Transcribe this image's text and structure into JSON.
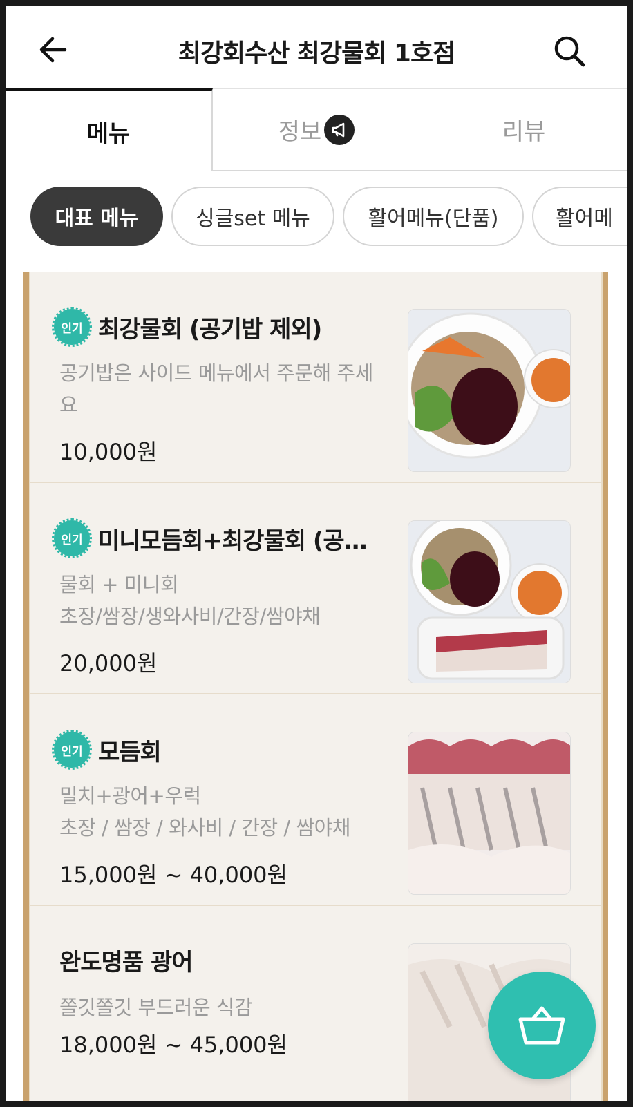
{
  "header": {
    "title": "최강회수산 최강물회 1호점",
    "back_icon": "arrow-left-icon",
    "search_icon": "search-icon"
  },
  "tabs": [
    {
      "label": "메뉴",
      "active": true
    },
    {
      "label": "정보",
      "icon": "megaphone-icon"
    },
    {
      "label": "리뷰"
    }
  ],
  "chips": [
    {
      "label": "대표 메뉴",
      "active": true
    },
    {
      "label": "싱글set 메뉴"
    },
    {
      "label": "활어메뉴(단품)"
    },
    {
      "label": "활어메"
    }
  ],
  "items": [
    {
      "badge": "인기",
      "name": "최강물회 (공기밥 제외)",
      "desc": "공기밥은 사이드 메뉴에서 주문해 주세요",
      "desc2": "",
      "price": "10,000원"
    },
    {
      "badge": "인기",
      "name": "미니모듬회+최강물회 (공기밥 제외)",
      "desc": "물회 + 미니회",
      "desc2": "초장/쌈장/생와사비/간장/쌈야채",
      "price": "20,000원"
    },
    {
      "badge": "인기",
      "name": "모듬회",
      "desc": "밀치+광어+우럭",
      "desc2": "초장 / 쌈장 / 와사비 / 간장 / 쌈야채",
      "price": "15,000원 ~ 40,000원"
    },
    {
      "badge": "",
      "name": "완도명품 광어",
      "desc": "쫄깃쫄깃 부드러운 식감",
      "desc2": "",
      "price": "18,000원 ~ 45,000원"
    }
  ],
  "cart": {
    "icon": "shopping-basket-icon"
  },
  "colors": {
    "accent": "#2fbfb0",
    "frame": "#c9a26d",
    "chip_active": "#3a3a3a"
  }
}
